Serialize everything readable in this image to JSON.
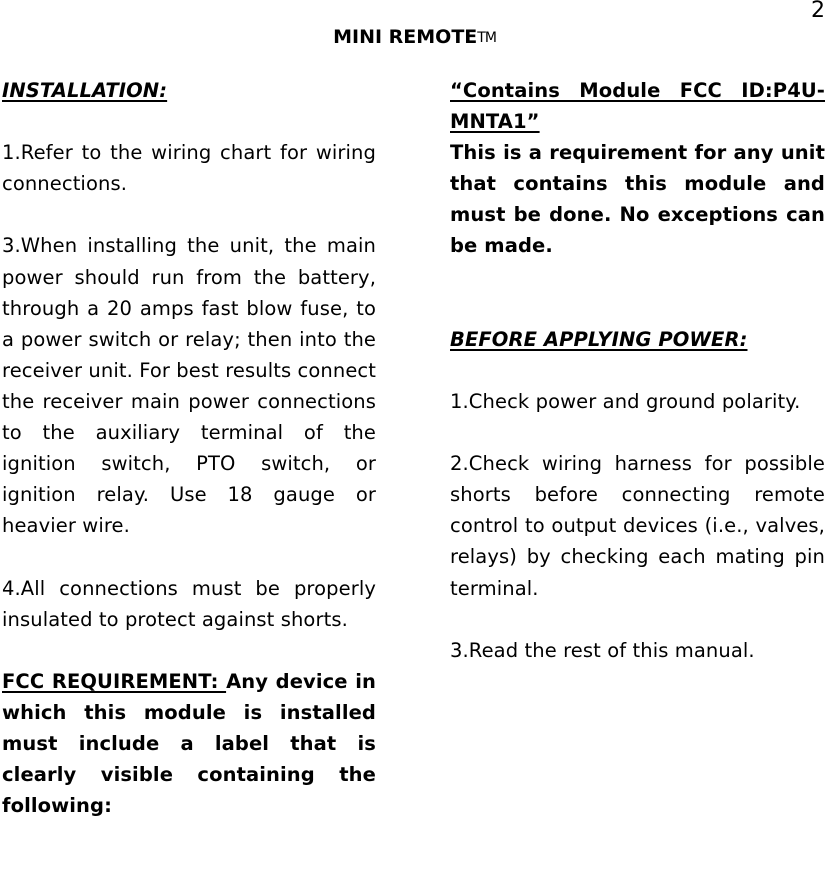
{
  "page": {
    "number": "2",
    "header_title": "MINI REMOTE",
    "header_trademark": "TM"
  },
  "left_column": {
    "installation_heading": "INSTALLATION:",
    "item1": "1.Refer to the wiring chart for wiring connections.",
    "item3_part1": "3.When installing the unit, the main power should run from the battery, through a 20 amps fast blow fuse, to a power switch or relay; then into the receiver unit.",
    "item3_part2": " For best results connect the receiver main power connections to the auxiliary terminal of the ignition switch, PTO switch, or ignition relay.  Use 18 gauge or heavier wire.",
    "item4": "4.All connections must be properly insulated to protect against shorts.",
    "fcc_label": "FCC REQUIREMENT: ",
    "fcc_text": " Any device in which this module is installed must include a label that is clearly visible containing the following:"
  },
  "right_column": {
    "fcc_id_label": "“Contains Module FCC ID:P4U-MNTA1”",
    "fcc_note": "This is a requirement for any unit that contains this module and must be done.   No exceptions can be made.",
    "before_power_heading": "BEFORE APPLYING POWER:",
    "item1": "1.Check power and ground polarity.",
    "item2": "2.Check wiring harness for possible shorts before connecting remote control to output devices (i.e., valves, relays) by checking each mating pin terminal.",
    "item3": "3.Read the rest of this manual."
  }
}
